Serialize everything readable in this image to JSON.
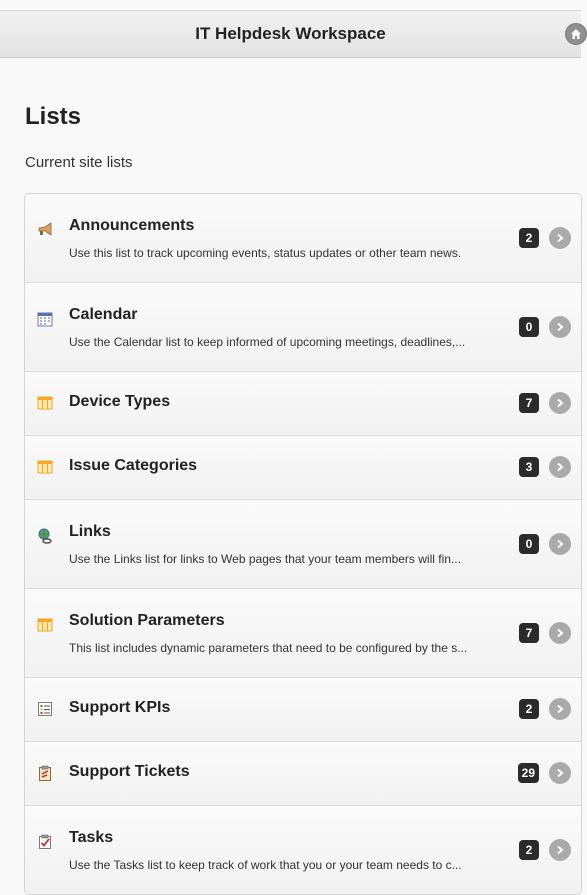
{
  "header": {
    "title": "IT Helpdesk Workspace",
    "home_icon": "home-icon"
  },
  "page": {
    "title": "Lists",
    "subtitle": "Current site lists"
  },
  "lists": [
    {
      "title": "Announcements",
      "description": "Use this list to track upcoming events, status updates or other team news.",
      "count": "2",
      "icon": "megaphone-icon"
    },
    {
      "title": "Calendar",
      "description": "Use the Calendar list to keep informed of upcoming meetings, deadlines,...",
      "count": "0",
      "icon": "calendar-icon"
    },
    {
      "title": "Device Types",
      "description": "",
      "count": "7",
      "icon": "table-icon"
    },
    {
      "title": "Issue Categories",
      "description": "",
      "count": "3",
      "icon": "table-icon"
    },
    {
      "title": "Links",
      "description": "Use the Links list for links to Web pages that your team members will fin...",
      "count": "0",
      "icon": "links-icon"
    },
    {
      "title": "Solution Parameters",
      "description": "This list includes dynamic parameters that need to be configured by the s...",
      "count": "7",
      "icon": "table-icon"
    },
    {
      "title": "Support KPIs",
      "description": "",
      "count": "2",
      "icon": "kpi-icon"
    },
    {
      "title": "Support Tickets",
      "description": "",
      "count": "29",
      "icon": "clipboard-icon"
    },
    {
      "title": "Tasks",
      "description": "Use the Tasks list to keep track of work that you or your team needs to c...",
      "count": "2",
      "icon": "tasks-icon"
    }
  ],
  "colors": {
    "badge": "#2b2b2b",
    "arrow": "#aaaaaa",
    "table_icon": "#f5a623"
  }
}
